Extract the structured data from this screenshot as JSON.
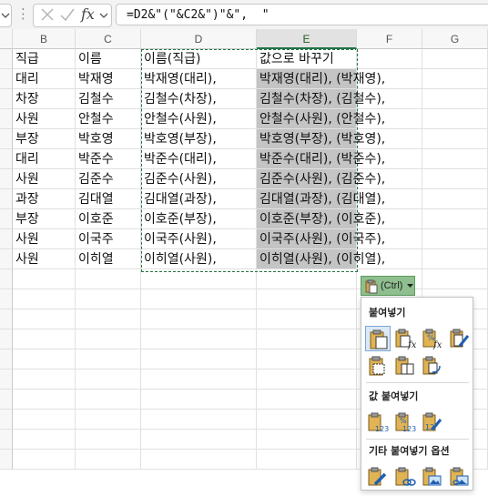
{
  "formula_bar": {
    "formula": "=D2&\"(\"&C2&\")\"&\",  \"",
    "fx_label": "fx"
  },
  "columns": [
    "B",
    "C",
    "D",
    "E",
    "F",
    "G"
  ],
  "selected_column": "E",
  "rows": [
    [
      "직급",
      "이름",
      "이름(직급)",
      "값으로 바꾸기",
      ""
    ],
    [
      "대리",
      "박재영",
      "박재영(대리),",
      "박재영(대리), (박재영),",
      ""
    ],
    [
      "차장",
      "김철수",
      "김철수(차장),",
      "김철수(차장), (김철수),",
      ""
    ],
    [
      "사원",
      "안철수",
      "안철수(사원),",
      "안철수(사원), (안철수),",
      ""
    ],
    [
      "부장",
      "박호영",
      "박호영(부장),",
      "박호영(부장), (박호영),",
      ""
    ],
    [
      "대리",
      "박준수",
      "박준수(대리),",
      "박준수(대리), (박준수),",
      ""
    ],
    [
      "사원",
      "김준수",
      "김준수(사원),",
      "김준수(사원), (김준수),",
      ""
    ],
    [
      "과장",
      "김대열",
      "김대열(과장),",
      "김대열(과장), (김대열),",
      ""
    ],
    [
      "부장",
      "이호준",
      "이호준(부장),",
      "이호준(부장), (이호준),",
      ""
    ],
    [
      "사원",
      "이국주",
      "이국주(사원),",
      "이국주(사원), (이국주),",
      ""
    ],
    [
      "사원",
      "이히열",
      "이히열(사원),",
      "이히열(사원), (이히열),",
      ""
    ]
  ],
  "paste_options": {
    "ctrl_label": "(Ctrl)",
    "sections": {
      "paste": "붙여넣기",
      "paste_values": "값 붙여넣기",
      "other": "기타 붙여넣기 옵션"
    },
    "paste_icons": [
      "paste-icon",
      "paste-formulas-icon",
      "paste-formulas-number-format-icon",
      "paste-keep-source-formatting-icon",
      "paste-no-borders-icon",
      "paste-keep-column-widths-icon",
      "paste-transpose-icon"
    ],
    "values_icons": [
      "paste-values-icon",
      "paste-values-number-format-icon",
      "paste-values-source-formatting-icon"
    ],
    "other_icons": [
      "paste-formatting-icon",
      "paste-link-icon",
      "paste-picture-icon",
      "paste-linked-picture-icon"
    ]
  },
  "colors": {
    "accent": "#217346",
    "selection_fill": "#c4c4c4",
    "ctrl_button": "#8fbf8f"
  }
}
